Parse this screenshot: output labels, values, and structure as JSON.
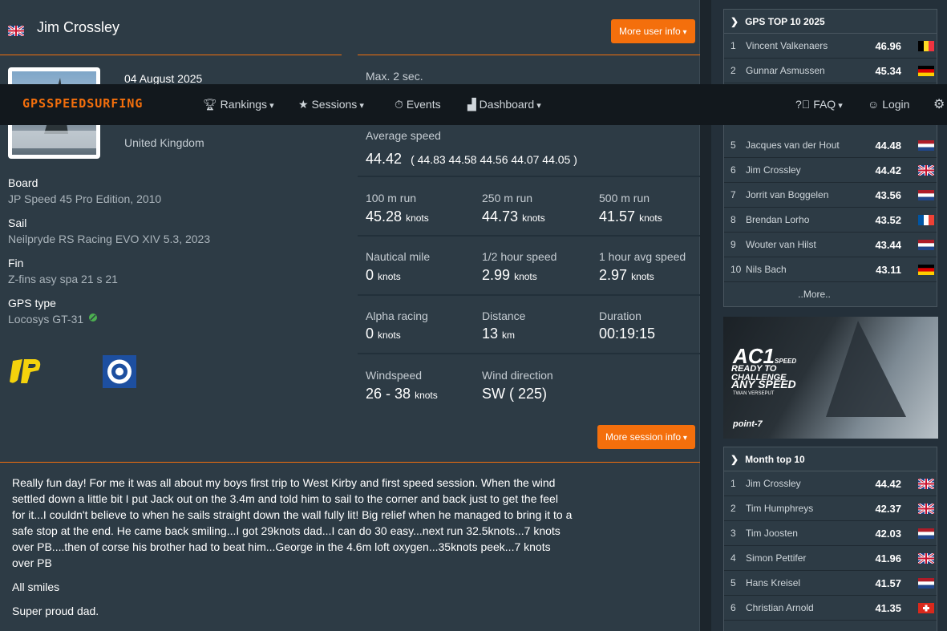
{
  "user": {
    "name": "Jim Crossley",
    "more_info_label": "More user info"
  },
  "session": {
    "date": "04 August 2025",
    "country": "United Kingdom",
    "more_info_label": "More session info"
  },
  "equipment": {
    "board_label": "Board",
    "board": "JP Speed 45 Pro Edition, 2010",
    "sail_label": "Sail",
    "sail": "Neilpryde RS Racing EVO XIV 5.3, 2023",
    "fin_label": "Fin",
    "fin": "Z-fins asy spa 21 s 21",
    "gps_label": "GPS type",
    "gps": "Locosys GT-31"
  },
  "stats": {
    "max2_label": "Max. 2 sec.",
    "avg_label": "Average speed",
    "avg_value": "44.42",
    "avg_runs": "( 44.83 44.58 44.56 44.07 44.05 )",
    "unit_knots": "knots",
    "unit_km": "km",
    "r100_label": "100 m run",
    "r100": "45.28",
    "r250_label": "250 m run",
    "r250": "44.73",
    "r500_label": "500 m run",
    "r500": "41.57",
    "nm_label": "Nautical mile",
    "nm": "0",
    "half_label": "1/2 hour speed",
    "half": "2.99",
    "hour_label": "1 hour avg speed",
    "hour": "2.97",
    "alpha_label": "Alpha racing",
    "alpha": "0",
    "dist_label": "Distance",
    "dist": "13",
    "dur_label": "Duration",
    "dur": "00:19:15",
    "wind_label": "Windspeed",
    "wind": "26 - 38",
    "dir_label": "Wind direction",
    "dir": "SW ( 225)"
  },
  "description": {
    "p1": "Really fun day!  For me it was all about my boys first trip to West Kirby and first speed session.  When the wind settled down a little bit I put Jack out on the 3.4m and told him to sail to the corner and back just to get the feel for it...I couldn't believe to when he sails straight down the wall fully lit!  Big relief when he managed to bring it to a safe stop at the end.  He came back smiling...I got 29knots dad...I can do 30 easy...next run 32.5knots...7 knots over PB....then of corse his brother had to beat him...George in the 4.6m loft oxygen...35knots peek...7 knots over PB",
    "p2": "All smiles",
    "p3": "Super proud dad."
  },
  "nav": {
    "logo": "GPSSPEEDSURFING",
    "rankings": "Rankings",
    "sessions": "Sessions",
    "events": "Events",
    "dashboard": "Dashboard",
    "faq": "FAQ",
    "login": "Login"
  },
  "top10_2025": {
    "title": "GPS TOP 10 2025",
    "rows": [
      {
        "rank": "1",
        "name": "Vincent Valkenaers",
        "value": "46.96",
        "flag": "BE"
      },
      {
        "rank": "2",
        "name": "Gunnar Asmussen",
        "value": "45.34",
        "flag": "DE"
      },
      {
        "rank": "5",
        "name": "Jacques van der Hout",
        "value": "44.48",
        "flag": "NL"
      },
      {
        "rank": "6",
        "name": "Jim Crossley",
        "value": "44.42",
        "flag": "GB"
      },
      {
        "rank": "7",
        "name": "Jorrit van Boggelen",
        "value": "43.56",
        "flag": "NL"
      },
      {
        "rank": "8",
        "name": "Brendan Lorho",
        "value": "43.52",
        "flag": "FR"
      },
      {
        "rank": "9",
        "name": "Wouter van Hilst",
        "value": "43.44",
        "flag": "NL"
      },
      {
        "rank": "10",
        "name": "Nils Bach",
        "value": "43.11",
        "flag": "DE"
      }
    ],
    "more": "..More.."
  },
  "ad": {
    "line1": "AC1",
    "line1b": "SPEED",
    "line2": "READY TO CHALLENGE",
    "line3": "ANY SPEED",
    "line4": "TWAN VERSEPUT",
    "brand": "point-7"
  },
  "month_top10": {
    "title": "Month top 10",
    "rows": [
      {
        "rank": "1",
        "name": "Jim Crossley",
        "value": "44.42",
        "flag": "GB"
      },
      {
        "rank": "2",
        "name": "Tim Humphreys",
        "value": "42.37",
        "flag": "GB"
      },
      {
        "rank": "3",
        "name": "Tim Joosten",
        "value": "42.03",
        "flag": "NL"
      },
      {
        "rank": "4",
        "name": "Simon Pettifer",
        "value": "41.96",
        "flag": "GB"
      },
      {
        "rank": "5",
        "name": "Hans Kreisel",
        "value": "41.57",
        "flag": "NL"
      },
      {
        "rank": "6",
        "name": "Christian Arnold",
        "value": "41.35",
        "flag": "CH"
      }
    ]
  },
  "colors": {
    "accent": "#f46f0c",
    "navbar": "#12181d",
    "panel": "#2d3b45"
  }
}
